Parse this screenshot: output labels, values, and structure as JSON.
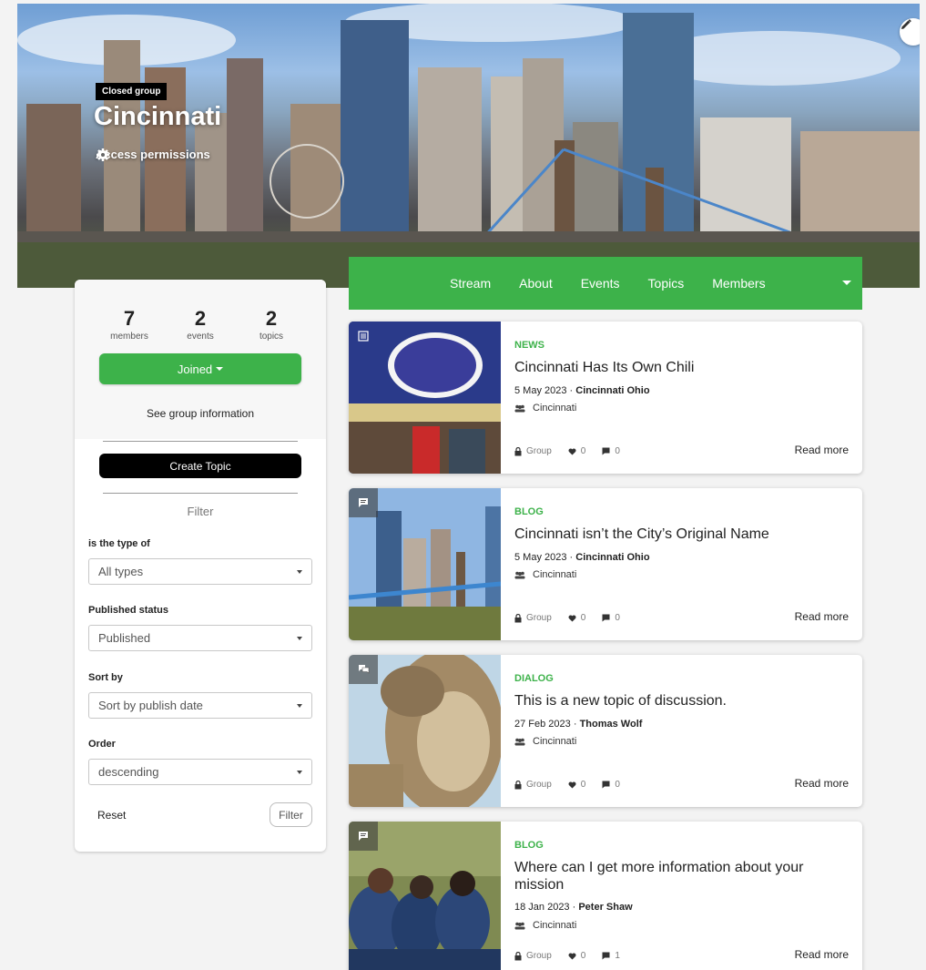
{
  "hero": {
    "badge": "Closed group",
    "title": "Cincinnati",
    "access_label": "Access permissions"
  },
  "tabs": [
    {
      "label": "Stream"
    },
    {
      "label": "About"
    },
    {
      "label": "Events"
    },
    {
      "label": "Topics"
    },
    {
      "label": "Members"
    }
  ],
  "sidebar": {
    "stats": [
      {
        "value": "7",
        "label": "members"
      },
      {
        "value": "2",
        "label": "events"
      },
      {
        "value": "2",
        "label": "topics"
      }
    ],
    "joined_label": "Joined",
    "see_info_label": "See group information",
    "create_topic_label": "Create Topic",
    "filter_heading": "Filter",
    "filters": [
      {
        "label": "is the type of",
        "value": "All types"
      },
      {
        "label": "Published status",
        "value": "Published"
      },
      {
        "label": "Sort by",
        "value": "Sort by publish date"
      },
      {
        "label": "Order",
        "value": "descending"
      }
    ],
    "reset_label": "Reset",
    "filter_button_label": "Filter"
  },
  "cards": [
    {
      "type": "NEWS",
      "title": "Cincinnati Has Its Own Chili",
      "date": "5 May 2023 · ",
      "author": "Cincinnati Ohio",
      "group": "Cincinnati",
      "visibility": "Group",
      "likes": "0",
      "comments": "0",
      "read_more": "Read more",
      "icon": "news-icon"
    },
    {
      "type": "BLOG",
      "title": "Cincinnati isn’t the City’s Original Name",
      "date": "5 May 2023 · ",
      "author": "Cincinnati Ohio",
      "group": "Cincinnati",
      "visibility": "Group",
      "likes": "0",
      "comments": "0",
      "read_more": "Read more",
      "icon": "blog-icon"
    },
    {
      "type": "DIALOG",
      "title": "This is a new topic of discussion.",
      "date": "27 Feb 2023 · ",
      "author": "Thomas Wolf",
      "group": "Cincinnati",
      "visibility": "Group",
      "likes": "0",
      "comments": "0",
      "read_more": "Read more",
      "icon": "dialog-icon"
    },
    {
      "type": "BLOG",
      "title": "Where can I get more information about your mission",
      "date": "18 Jan 2023 · ",
      "author": "Peter Shaw",
      "group": "Cincinnati",
      "visibility": "Group",
      "likes": "0",
      "comments": "1",
      "read_more": "Read more",
      "icon": "blog-icon"
    }
  ],
  "colors": {
    "accent": "#3db24a",
    "dark": "#000000"
  }
}
